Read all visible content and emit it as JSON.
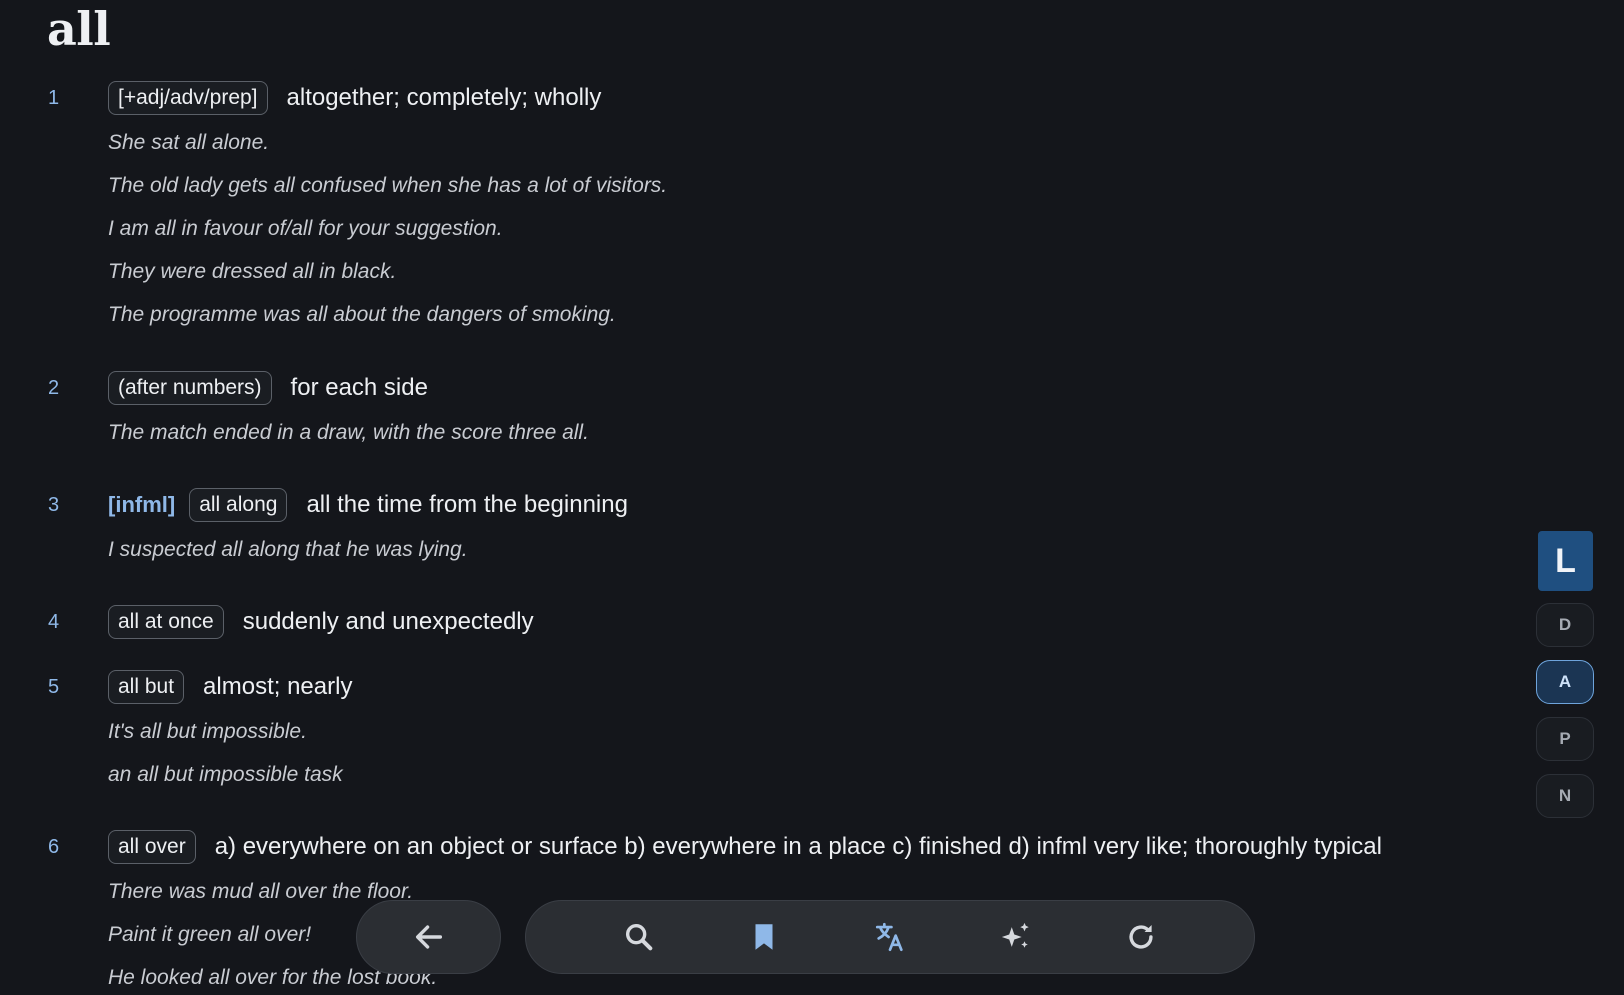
{
  "headword": "all",
  "senses": [
    {
      "num": "1",
      "tag": "[+adj/adv/prep]",
      "definition": "altogether; completely; wholly",
      "examples": [
        "She sat all alone.",
        "The old lady gets all confused when she has a lot of visitors.",
        "I am all in favour of/all for your suggestion.",
        "They were dressed all in black.",
        "The programme was all about the dangers of smoking."
      ]
    },
    {
      "num": "2",
      "tag": "(after numbers)",
      "definition": "for each side",
      "examples": [
        "The match ended in a draw, with the score three all."
      ]
    },
    {
      "num": "3",
      "register": "[infml]",
      "tag": "all along",
      "definition": "all the time from the beginning",
      "examples": [
        "I suspected all along that he was lying."
      ]
    },
    {
      "num": "4",
      "tag": "all at once",
      "definition": "suddenly and unexpectedly",
      "examples": []
    },
    {
      "num": "5",
      "tag": "all but",
      "definition": "almost; nearly",
      "examples": [
        "It's all but impossible.",
        "an all but impossible task"
      ]
    },
    {
      "num": "6",
      "tag": "all over",
      "definition": "a) everywhere on an object or surface b) everywhere in a place c) finished d) infml very like; thoroughly typical",
      "examples": [
        "There was mud all over the floor.",
        "Paint it green all over!",
        "He looked all over for the lost book."
      ]
    }
  ],
  "rail": [
    {
      "label": "L",
      "state": "primary"
    },
    {
      "label": "D",
      "state": "normal"
    },
    {
      "label": "A",
      "state": "selected"
    },
    {
      "label": "P",
      "state": "normal"
    },
    {
      "label": "N",
      "state": "normal"
    }
  ],
  "toolbar": {
    "back_icon": "arrow-left-icon",
    "tools": [
      "search-icon",
      "bookmark-icon",
      "translate-icon",
      "sparkles-icon",
      "refresh-icon"
    ]
  },
  "colors": {
    "background": "#14161b",
    "accent": "#8fb8e8",
    "rail_primary": "#1f4f80",
    "toolbar": "#2b2e33"
  }
}
